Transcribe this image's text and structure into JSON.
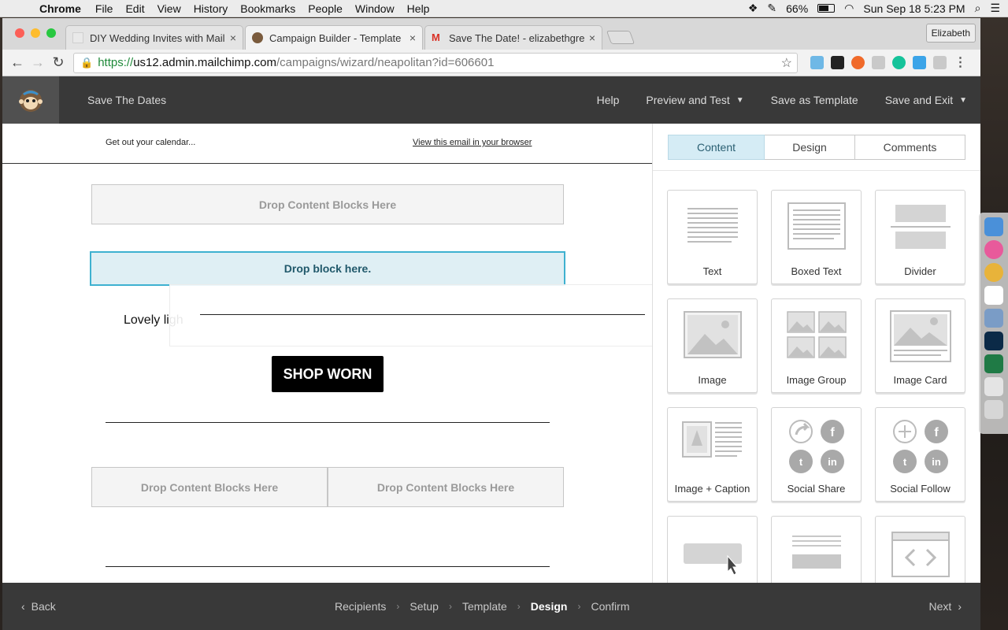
{
  "menubar": {
    "app": "Chrome",
    "items": [
      "File",
      "Edit",
      "View",
      "History",
      "Bookmarks",
      "People",
      "Window",
      "Help"
    ],
    "battery": "66%",
    "datetime": "Sun Sep 18  5:23 PM"
  },
  "browser": {
    "tabs": [
      {
        "title": "DIY Wedding Invites with Mailc",
        "close": "×"
      },
      {
        "title": "Campaign Builder - Template D",
        "close": "×"
      },
      {
        "title": "Save The Date! - elizabethgree",
        "close": "×"
      }
    ],
    "profile": "Elizabeth",
    "url": {
      "scheme": "https://",
      "host": "us12.admin.mailchimp.com",
      "path": "/campaigns/wizard/neapolitan?id=606601"
    }
  },
  "app": {
    "campaign_title": "Save The Dates",
    "nav": {
      "help": "Help",
      "preview": "Preview and Test",
      "save_template": "Save as Template",
      "save_exit": "Save and Exit"
    }
  },
  "canvas": {
    "preheader_left": "Get out your calendar...",
    "preheader_right": "View this email in your browser",
    "drop_zone_label": "Drop Content Blocks Here",
    "drop_active_label": "Drop block here.",
    "body_text": "Lovely ligh",
    "button_label": "SHOP WORN"
  },
  "panel": {
    "tabs": [
      "Content",
      "Design",
      "Comments"
    ],
    "active_tab": "Content",
    "blocks": [
      {
        "label": "Text",
        "icon": "text-lines-icon"
      },
      {
        "label": "Boxed Text",
        "icon": "boxed-text-icon"
      },
      {
        "label": "Divider",
        "icon": "divider-icon"
      },
      {
        "label": "Image",
        "icon": "image-icon"
      },
      {
        "label": "Image Group",
        "icon": "image-group-icon"
      },
      {
        "label": "Image Card",
        "icon": "image-card-icon"
      },
      {
        "label": "Image + Caption",
        "icon": "image-caption-icon"
      },
      {
        "label": "Social Share",
        "icon": "social-share-icon"
      },
      {
        "label": "Social Follow",
        "icon": "social-follow-icon"
      },
      {
        "label": "",
        "icon": "button-block-icon"
      },
      {
        "label": "",
        "icon": "footer-block-icon"
      },
      {
        "label": "",
        "icon": "code-block-icon"
      }
    ]
  },
  "wizard": {
    "back": "Back",
    "steps": [
      "Recipients",
      "Setup",
      "Template",
      "Design",
      "Confirm"
    ],
    "current_step": "Design",
    "next": "Next"
  },
  "colors": {
    "header_bg": "#393939",
    "active_tab_bg": "#d5ecf5",
    "drop_active_border": "#3eb1d0",
    "drop_active_bg": "#dfeff4"
  }
}
